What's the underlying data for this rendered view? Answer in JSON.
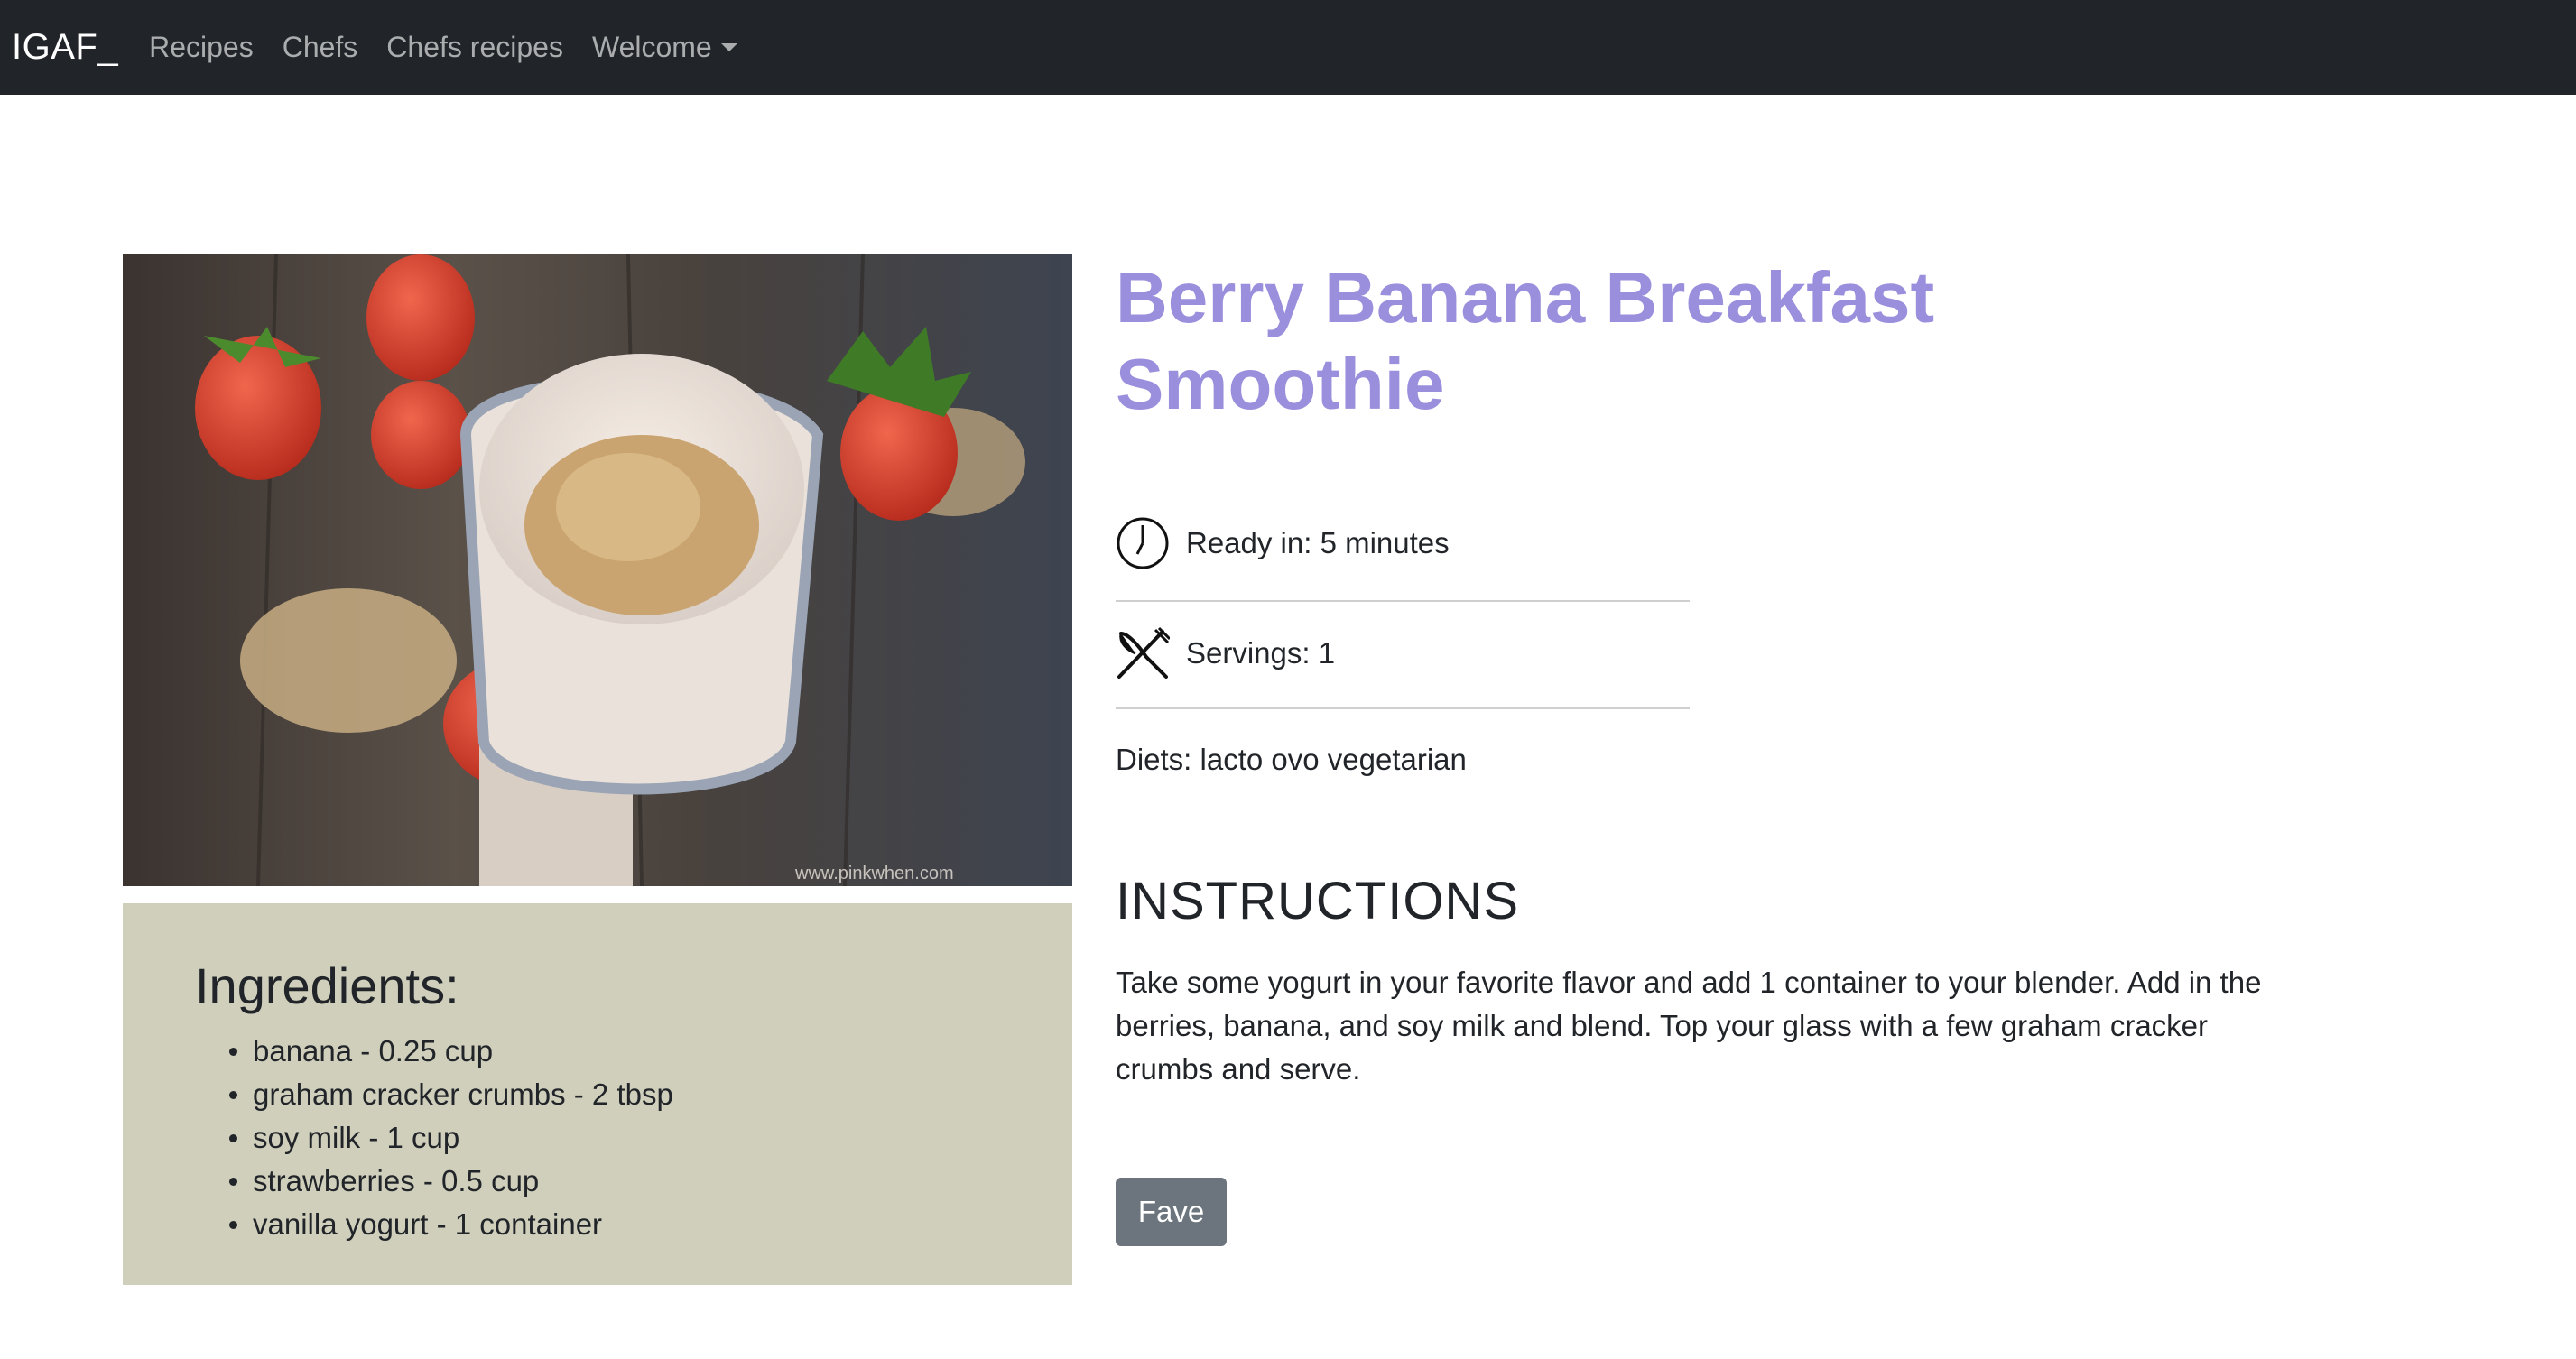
{
  "nav": {
    "brand": "IGAF_",
    "links": [
      "Recipes",
      "Chefs",
      "Chefs recipes"
    ],
    "dropdown_label": "Welcome"
  },
  "recipe": {
    "title": "Berry Banana Breakfast Smoothie",
    "ready_in": "Ready in: 5 minutes",
    "servings": "Servings: 1",
    "diets": "Diets: lacto ovo vegetarian",
    "image_watermark": "www.pinkwhen.com"
  },
  "ingredients": {
    "heading": "Ingredients:",
    "items": [
      "banana - 0.25 cup",
      "graham cracker crumbs - 2 tbsp",
      "soy milk - 1 cup",
      "strawberries - 0.5 cup",
      "vanilla yogurt - 1 container"
    ]
  },
  "instructions": {
    "heading": "INSTRUCTIONS",
    "text": "Take some yogurt in your favorite flavor and add 1 container to your blender. Add in the berries, banana, and soy milk and blend. Top your glass with a few graham cracker crumbs and serve."
  },
  "actions": {
    "fave_label": "Fave"
  },
  "colors": {
    "navbar_bg": "#212529",
    "title": "#9a8fdc",
    "ingredients_bg": "#cfcfbb",
    "button_bg": "#6c757d"
  },
  "icons": {
    "ready_in": "clock-icon",
    "servings": "fork-knife-icon",
    "dropdown": "caret-down-icon"
  }
}
